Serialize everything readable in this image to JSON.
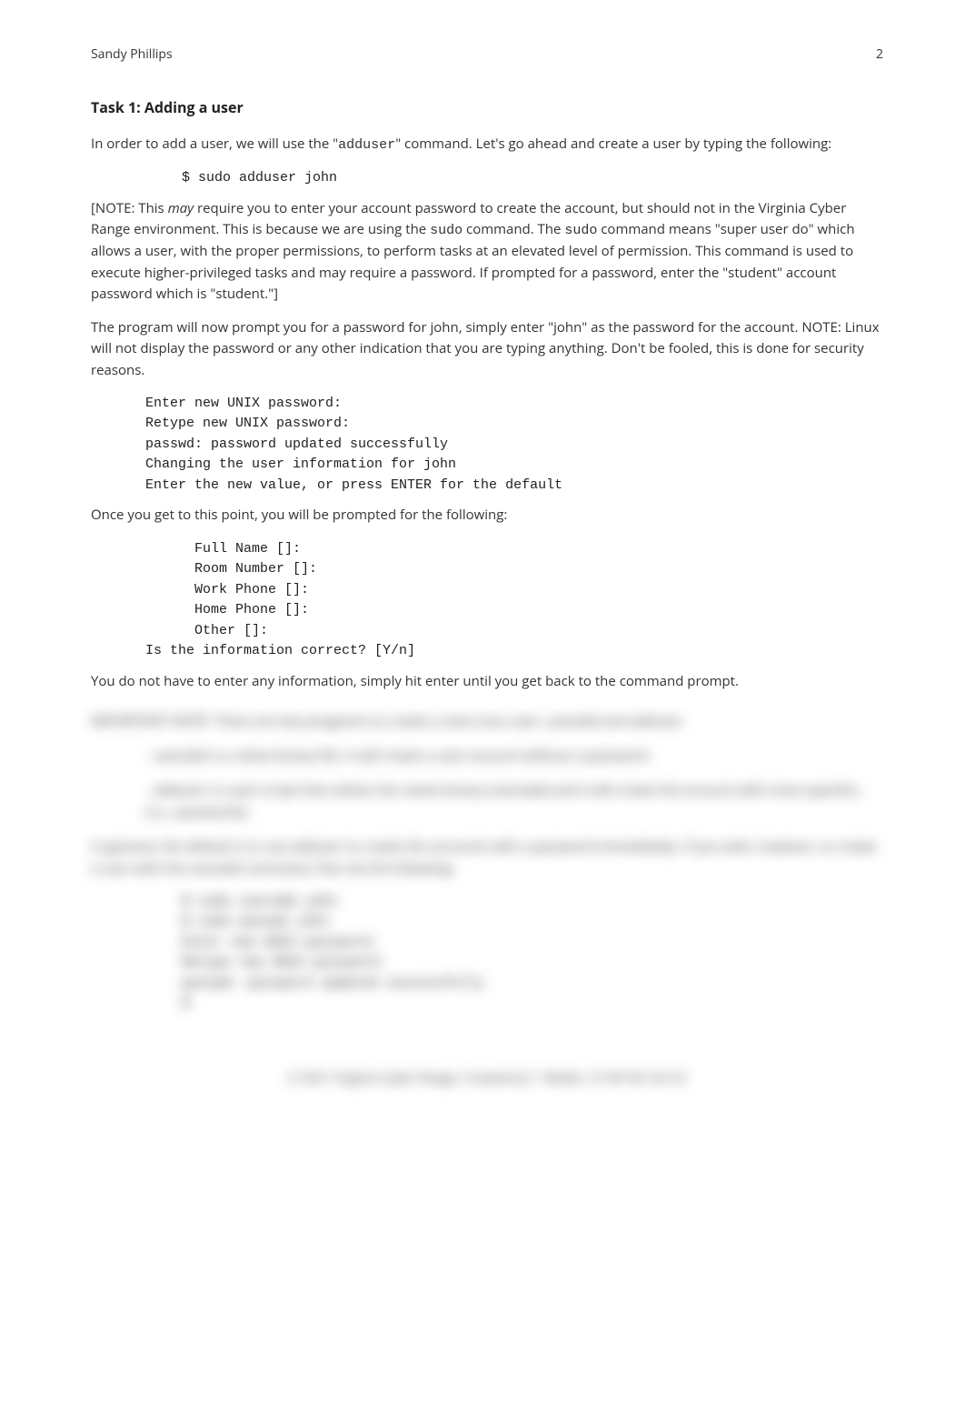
{
  "header": {
    "author": "Sandy Phillips",
    "page_number": "2"
  },
  "task_title": "Task 1: Adding a user",
  "para1_a": "In order to add a user, we will use the \"",
  "para1_cmd": "adduser",
  "para1_b": "\" command. Let's go ahead and create a user by typing the following:",
  "cmd1": "$ sudo adduser john",
  "note1_a": "[NOTE: This ",
  "note1_may": "may",
  "note1_b": " require you to enter your account password to create the account, but should not in the Virginia Cyber Range environment. This is because we are using the ",
  "note1_sudo1": "sudo",
  "note1_c": " command. The ",
  "note1_sudo2": "sudo",
  "note1_d": " command means \"super user do\" which allows a user, with the proper permissions, to perform tasks at an elevated level of permission. This command is used to execute higher-privileged tasks and may require a password. If prompted for a password, enter the \"student\" account password which is \"student.\"]",
  "para2": "The program will now prompt you for a password for john, simply enter \"john\" as the password for the account. NOTE: Linux will not display the password or any other indication that you are typing anything. Don't be fooled, this is done for security reasons.",
  "cmd2": "Enter new UNIX password:\nRetype new UNIX password:\npasswd: password updated successfully\nChanging the user information for john\nEnter the new value, or press ENTER for the default",
  "para3": "Once you get to this point, you will be prompted for the following:",
  "cmd3": "      Full Name []:\n      Room Number []:\n      Work Phone []:\n      Home Phone []:\n      Other []:\nIs the information correct? [Y/n]",
  "para4": "You do not have to enter any information, simply hit enter until you get back to the command prompt.",
  "blurred": {
    "line1": "IMPORTANT NOTE: There are two programs to create a new Linux user, useradd and adduser.",
    "bullet1": "- useradd is a native binary file. It will create a user account without a password.",
    "bullet2": "- adduser is a perl script that utilizes the native binary (useradd) and it will create the account with more specifics (i.e., passwords).",
    "line2": "In general, the default is to use adduser to create the accounts with a password immediately. If you wish, however, to create a user with the useradd command, then do the following:",
    "cmd": "$ sudo useradd john\n$ sudo passwd john\nEnter new UNIX password:\nRetype new UNIX password:\npasswd: password updated successfully\n$",
    "footer": "© 2021 Virginia Cyber Range. Created by T. Weeks. CC BY-NC-SA 4.0"
  }
}
